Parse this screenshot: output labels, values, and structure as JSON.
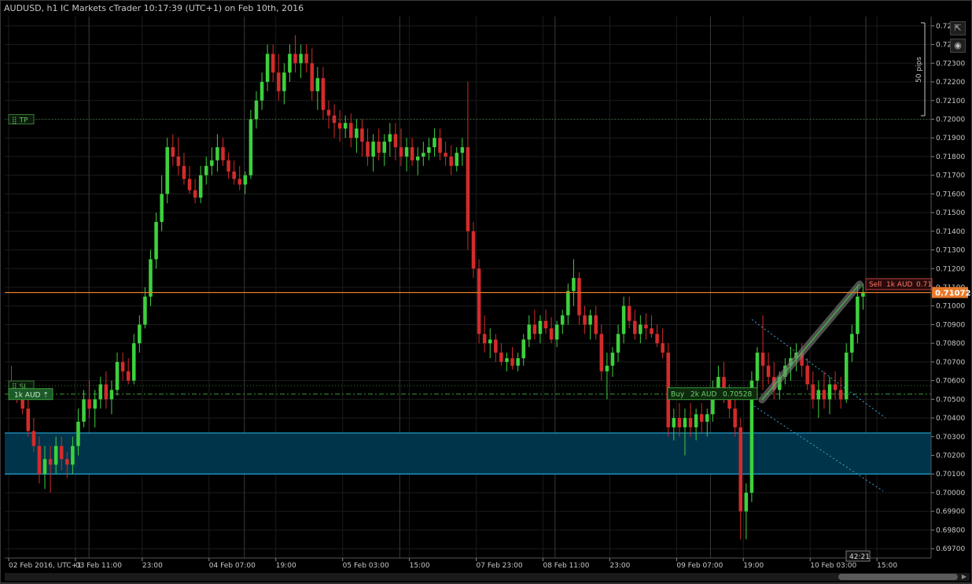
{
  "window": {
    "title": "AUDUSD, h1 IC Markets cTrader 10:17:39 (UTC+1) on Feb 10th, 2016"
  },
  "toolbar": {
    "detach_icon": "external-link-icon",
    "screenshot_icon": "camera-icon"
  },
  "scale_bar": {
    "label": "50 pips"
  },
  "price_axis": {
    "ticks": [
      "0.72500",
      "0.72400",
      "0.72300",
      "0.72200",
      "0.72100",
      "0.72000",
      "0.71900",
      "0.71800",
      "0.71700",
      "0.71600",
      "0.71500",
      "0.71400",
      "0.71300",
      "0.71200",
      "0.71100",
      "0.71000",
      "0.70900",
      "0.70800",
      "0.70700",
      "0.70600",
      "0.70500",
      "0.70400",
      "0.70300",
      "0.70200",
      "0.70100",
      "0.70000",
      "0.69900",
      "0.69800",
      "0.69700"
    ],
    "current_price_label": "0.71072"
  },
  "time_axis": {
    "labels": [
      "02 Feb 2016, UTC+1",
      "03 Feb 11:00",
      "23:00",
      "04 Feb 07:00",
      "19:00",
      "05 Feb 03:00",
      "15:00",
      "07 Feb 23:00",
      "08 Feb 11:00",
      "23:00",
      "09 Feb 07:00",
      "19:00",
      "10 Feb 03:00",
      "15:00"
    ],
    "countdown": "42:21"
  },
  "orders": {
    "tp_label": "TP",
    "sl_label": "SL",
    "position_label": "1k AUD",
    "buy_side": "Buy",
    "buy_qty": "2k AUD",
    "buy_price": "0.70528",
    "sell_side": "Sell",
    "sell_qty": "1k AUD",
    "sell_price": "0.71"
  },
  "colors": {
    "bull": "#3dd13d",
    "bear": "#d42b2b",
    "current_price": "#e87a2a",
    "zone_fill": "#00344a",
    "zone_border": "#1fa6d6",
    "grid": "#1c1c1c",
    "tp_sl": "#3a7a3a"
  },
  "chart_data": {
    "type": "candlestick",
    "symbol": "AUDUSD",
    "timeframe": "h1",
    "ylim": [
      0.6965,
      0.7255
    ],
    "current_price": 0.71072,
    "tp_level": 0.72,
    "sl_level": 0.70573,
    "buy_price": 0.70528,
    "zone": [
      0.701,
      0.7032
    ],
    "candles": [
      [
        0.706,
        0.7068,
        0.705,
        0.7055
      ],
      [
        0.7055,
        0.706,
        0.7048,
        0.7052
      ],
      [
        0.7052,
        0.7055,
        0.7042,
        0.7045
      ],
      [
        0.7045,
        0.705,
        0.703,
        0.7033
      ],
      [
        0.7033,
        0.704,
        0.7022,
        0.7025
      ],
      [
        0.7025,
        0.703,
        0.7005,
        0.701
      ],
      [
        0.701,
        0.7025,
        0.7002,
        0.7018
      ],
      [
        0.7018,
        0.7025,
        0.7,
        0.7015
      ],
      [
        0.7015,
        0.703,
        0.701,
        0.7025
      ],
      [
        0.7025,
        0.703,
        0.7012,
        0.7018
      ],
      [
        0.7018,
        0.7022,
        0.7008,
        0.7015
      ],
      [
        0.7015,
        0.703,
        0.701,
        0.7025
      ],
      [
        0.7025,
        0.7045,
        0.702,
        0.7038
      ],
      [
        0.7038,
        0.7055,
        0.7035,
        0.705
      ],
      [
        0.705,
        0.706,
        0.704,
        0.7045
      ],
      [
        0.7045,
        0.7055,
        0.7035,
        0.705
      ],
      [
        0.705,
        0.7062,
        0.7045,
        0.7058
      ],
      [
        0.7058,
        0.7065,
        0.7045,
        0.705
      ],
      [
        0.705,
        0.706,
        0.7042,
        0.7055
      ],
      [
        0.7055,
        0.7075,
        0.7052,
        0.707
      ],
      [
        0.707,
        0.7075,
        0.706,
        0.7065
      ],
      [
        0.7065,
        0.7072,
        0.7058,
        0.706
      ],
      [
        0.706,
        0.7085,
        0.7058,
        0.708
      ],
      [
        0.708,
        0.7095,
        0.7075,
        0.709
      ],
      [
        0.709,
        0.711,
        0.7088,
        0.7105
      ],
      [
        0.7105,
        0.713,
        0.71,
        0.7125
      ],
      [
        0.7125,
        0.715,
        0.712,
        0.7145
      ],
      [
        0.7145,
        0.717,
        0.714,
        0.716
      ],
      [
        0.716,
        0.719,
        0.7155,
        0.7185
      ],
      [
        0.7185,
        0.7192,
        0.7175,
        0.718
      ],
      [
        0.718,
        0.719,
        0.717,
        0.7175
      ],
      [
        0.7175,
        0.7182,
        0.7165,
        0.7168
      ],
      [
        0.7168,
        0.7175,
        0.716,
        0.7162
      ],
      [
        0.7162,
        0.7168,
        0.7155,
        0.7158
      ],
      [
        0.7158,
        0.7175,
        0.7155,
        0.717
      ],
      [
        0.717,
        0.718,
        0.7165,
        0.7175
      ],
      [
        0.7175,
        0.7185,
        0.717,
        0.7178
      ],
      [
        0.7178,
        0.7192,
        0.7172,
        0.7185
      ],
      [
        0.7185,
        0.719,
        0.7175,
        0.7178
      ],
      [
        0.7178,
        0.7182,
        0.7168,
        0.7172
      ],
      [
        0.7172,
        0.7178,
        0.7165,
        0.7168
      ],
      [
        0.7168,
        0.7175,
        0.7162,
        0.7165
      ],
      [
        0.7165,
        0.7172,
        0.716,
        0.717
      ],
      [
        0.717,
        0.7205,
        0.7168,
        0.72
      ],
      [
        0.72,
        0.7215,
        0.7195,
        0.721
      ],
      [
        0.721,
        0.7225,
        0.7205,
        0.722
      ],
      [
        0.722,
        0.724,
        0.7215,
        0.7235
      ],
      [
        0.7235,
        0.724,
        0.722,
        0.7225
      ],
      [
        0.7225,
        0.7235,
        0.721,
        0.7215
      ],
      [
        0.7215,
        0.723,
        0.7208,
        0.7225
      ],
      [
        0.7225,
        0.724,
        0.722,
        0.7235
      ],
      [
        0.7235,
        0.7245,
        0.7225,
        0.723
      ],
      [
        0.723,
        0.724,
        0.7222,
        0.7235
      ],
      [
        0.7235,
        0.724,
        0.7225,
        0.723
      ],
      [
        0.723,
        0.7238,
        0.721,
        0.7215
      ],
      [
        0.7215,
        0.7228,
        0.7205,
        0.7222
      ],
      [
        0.7222,
        0.7228,
        0.72,
        0.7205
      ],
      [
        0.7205,
        0.721,
        0.7195,
        0.7202
      ],
      [
        0.7202,
        0.7208,
        0.719,
        0.7198
      ],
      [
        0.7198,
        0.7205,
        0.7188,
        0.7195
      ],
      [
        0.7195,
        0.7202,
        0.719,
        0.7198
      ],
      [
        0.7198,
        0.7203,
        0.7185,
        0.719
      ],
      [
        0.719,
        0.72,
        0.7182,
        0.7195
      ],
      [
        0.7195,
        0.72,
        0.718,
        0.7188
      ],
      [
        0.7188,
        0.7195,
        0.7175,
        0.718
      ],
      [
        0.718,
        0.7192,
        0.7172,
        0.7188
      ],
      [
        0.7188,
        0.7195,
        0.7178,
        0.7182
      ],
      [
        0.7182,
        0.7192,
        0.7175,
        0.7188
      ],
      [
        0.7188,
        0.7198,
        0.718,
        0.7192
      ],
      [
        0.7192,
        0.7198,
        0.7178,
        0.7185
      ],
      [
        0.7185,
        0.7195,
        0.7175,
        0.718
      ],
      [
        0.718,
        0.719,
        0.7172,
        0.7185
      ],
      [
        0.7185,
        0.719,
        0.7175,
        0.7178
      ],
      [
        0.7178,
        0.7185,
        0.717,
        0.718
      ],
      [
        0.718,
        0.7188,
        0.7175,
        0.7182
      ],
      [
        0.7182,
        0.719,
        0.7178,
        0.7185
      ],
      [
        0.7185,
        0.7195,
        0.718,
        0.719
      ],
      [
        0.719,
        0.7195,
        0.7178,
        0.7182
      ],
      [
        0.7182,
        0.7188,
        0.7175,
        0.718
      ],
      [
        0.718,
        0.7186,
        0.717,
        0.7175
      ],
      [
        0.7175,
        0.7185,
        0.7172,
        0.7182
      ],
      [
        0.7182,
        0.719,
        0.7175,
        0.7185
      ],
      [
        0.7185,
        0.722,
        0.713,
        0.714
      ],
      [
        0.714,
        0.7145,
        0.7115,
        0.712
      ],
      [
        0.712,
        0.7125,
        0.708,
        0.7085
      ],
      [
        0.7085,
        0.7095,
        0.7075,
        0.708
      ],
      [
        0.708,
        0.7088,
        0.7072,
        0.7082
      ],
      [
        0.7082,
        0.7085,
        0.707,
        0.7075
      ],
      [
        0.7075,
        0.708,
        0.7068,
        0.707
      ],
      [
        0.707,
        0.7075,
        0.7065,
        0.7072
      ],
      [
        0.7072,
        0.7078,
        0.7066,
        0.7068
      ],
      [
        0.7068,
        0.7075,
        0.7065,
        0.7072
      ],
      [
        0.7072,
        0.7085,
        0.7068,
        0.7082
      ],
      [
        0.7082,
        0.7095,
        0.7078,
        0.709
      ],
      [
        0.709,
        0.7098,
        0.7082,
        0.7085
      ],
      [
        0.7085,
        0.7095,
        0.708,
        0.7092
      ],
      [
        0.7092,
        0.7098,
        0.7085,
        0.7088
      ],
      [
        0.7088,
        0.7094,
        0.708,
        0.7082
      ],
      [
        0.7082,
        0.7092,
        0.7078,
        0.709
      ],
      [
        0.709,
        0.7098,
        0.7085,
        0.7095
      ],
      [
        0.7095,
        0.7112,
        0.709,
        0.7108
      ],
      [
        0.7108,
        0.7125,
        0.71,
        0.7115
      ],
      [
        0.7115,
        0.7118,
        0.709,
        0.7095
      ],
      [
        0.7095,
        0.71,
        0.7085,
        0.709
      ],
      [
        0.709,
        0.7098,
        0.7082,
        0.7095
      ],
      [
        0.7095,
        0.71,
        0.7082,
        0.7085
      ],
      [
        0.7085,
        0.709,
        0.706,
        0.7065
      ],
      [
        0.7065,
        0.7075,
        0.705,
        0.7068
      ],
      [
        0.7068,
        0.7078,
        0.7062,
        0.7075
      ],
      [
        0.7075,
        0.709,
        0.707,
        0.7085
      ],
      [
        0.7085,
        0.7105,
        0.708,
        0.71
      ],
      [
        0.71,
        0.7105,
        0.7088,
        0.7092
      ],
      [
        0.7092,
        0.7098,
        0.7082,
        0.7085
      ],
      [
        0.7085,
        0.7095,
        0.708,
        0.709
      ],
      [
        0.709,
        0.7096,
        0.7082,
        0.7088
      ],
      [
        0.7088,
        0.7095,
        0.7083,
        0.7085
      ],
      [
        0.7085,
        0.709,
        0.7078,
        0.708
      ],
      [
        0.708,
        0.7088,
        0.7072,
        0.7075
      ],
      [
        0.7075,
        0.708,
        0.703,
        0.7035
      ],
      [
        0.7035,
        0.7045,
        0.7028,
        0.704
      ],
      [
        0.704,
        0.7048,
        0.703,
        0.7035
      ],
      [
        0.7035,
        0.7045,
        0.702,
        0.704
      ],
      [
        0.704,
        0.7048,
        0.703,
        0.7035
      ],
      [
        0.7035,
        0.7045,
        0.7028,
        0.7042
      ],
      [
        0.7042,
        0.7048,
        0.7032,
        0.7038
      ],
      [
        0.7038,
        0.7045,
        0.703,
        0.7042
      ],
      [
        0.7042,
        0.706,
        0.7038,
        0.7055
      ],
      [
        0.7055,
        0.7068,
        0.705,
        0.7062
      ],
      [
        0.7062,
        0.707,
        0.7048,
        0.7052
      ],
      [
        0.7052,
        0.7058,
        0.704,
        0.7045
      ],
      [
        0.7045,
        0.7052,
        0.703,
        0.7035
      ],
      [
        0.7035,
        0.704,
        0.6975,
        0.699
      ],
      [
        0.699,
        0.7005,
        0.6975,
        0.7
      ],
      [
        0.7,
        0.7065,
        0.6995,
        0.706
      ],
      [
        0.706,
        0.7078,
        0.7052,
        0.7075
      ],
      [
        0.7075,
        0.7095,
        0.7055,
        0.7068
      ],
      [
        0.7068,
        0.7075,
        0.7058,
        0.7062
      ],
      [
        0.7062,
        0.707,
        0.705,
        0.7055
      ],
      [
        0.7055,
        0.7065,
        0.705,
        0.7062
      ],
      [
        0.7062,
        0.7072,
        0.7058,
        0.7068
      ],
      [
        0.7068,
        0.7078,
        0.706,
        0.7072
      ],
      [
        0.7072,
        0.708,
        0.7065,
        0.7075
      ],
      [
        0.7075,
        0.708,
        0.7062,
        0.7068
      ],
      [
        0.7068,
        0.7072,
        0.7055,
        0.7058
      ],
      [
        0.7058,
        0.7065,
        0.7045,
        0.705
      ],
      [
        0.705,
        0.706,
        0.704,
        0.7055
      ],
      [
        0.7055,
        0.7065,
        0.7045,
        0.705
      ],
      [
        0.705,
        0.7062,
        0.7042,
        0.7058
      ],
      [
        0.7058,
        0.7065,
        0.705,
        0.7055
      ],
      [
        0.7055,
        0.7062,
        0.7045,
        0.705
      ],
      [
        0.705,
        0.708,
        0.7048,
        0.7075
      ],
      [
        0.7075,
        0.709,
        0.707,
        0.7085
      ],
      [
        0.7085,
        0.711,
        0.708,
        0.7105
      ],
      [
        0.7105,
        0.7112,
        0.7098,
        0.7107
      ]
    ]
  }
}
